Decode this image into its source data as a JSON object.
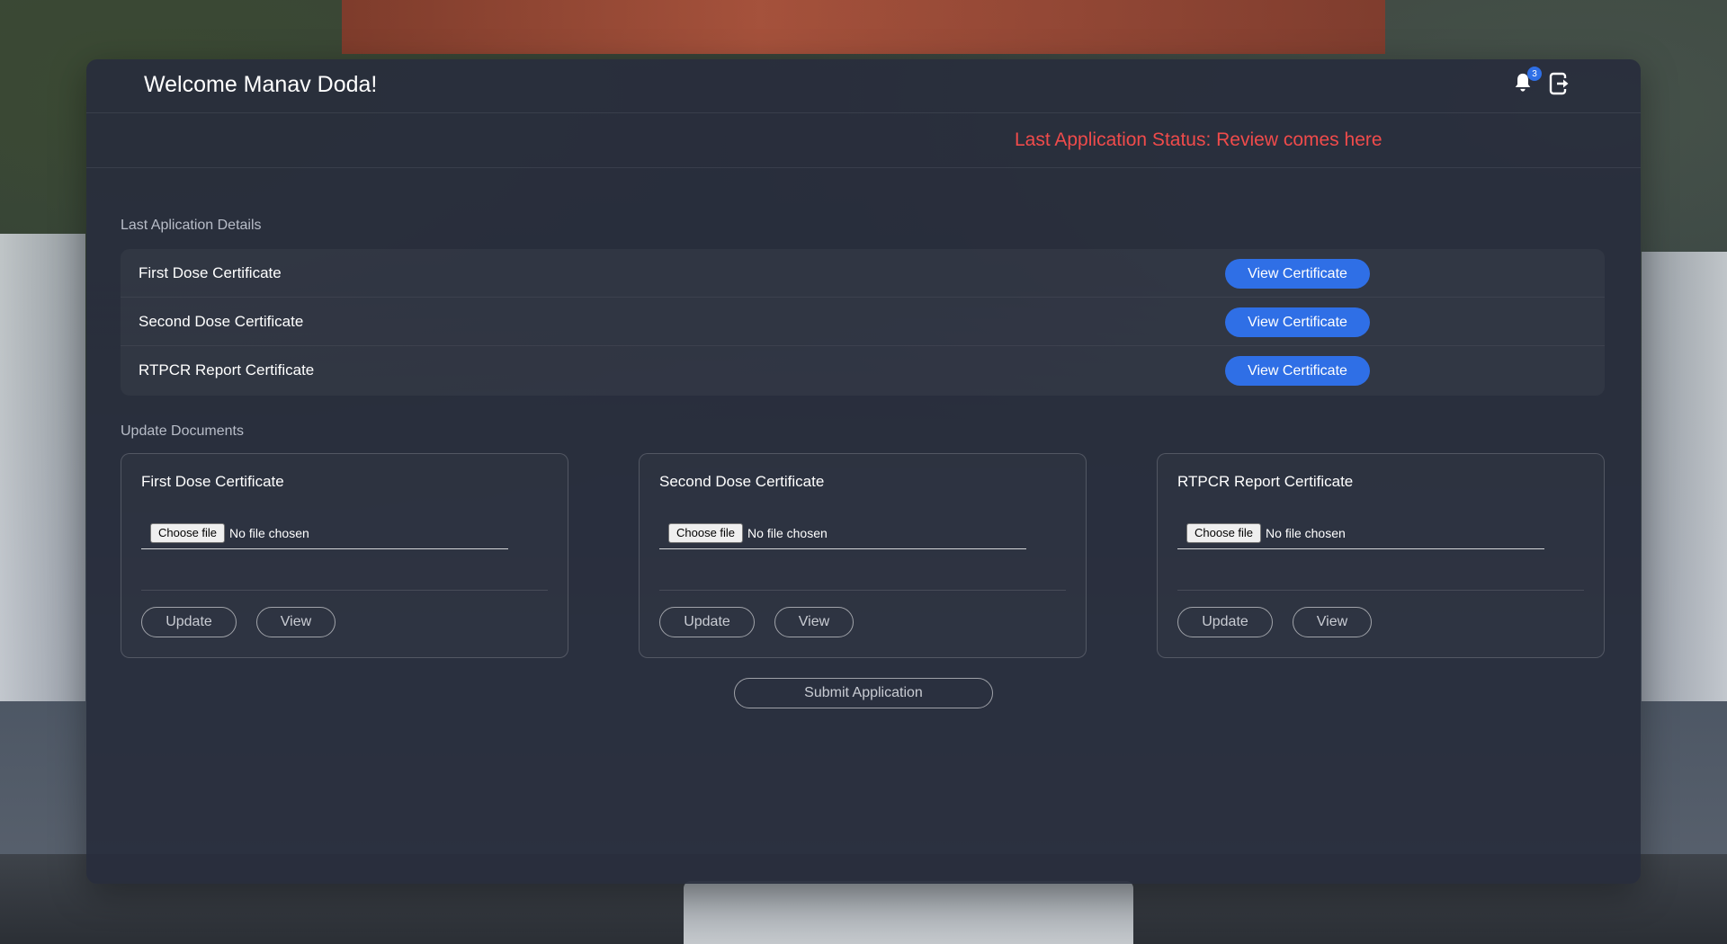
{
  "header": {
    "welcome": "Welcome Manav Doda!",
    "notification_count": "3",
    "notification_icon": "bell-icon",
    "logout_icon": "logout-icon"
  },
  "status": {
    "text": "Last Application Status: Review comes here",
    "color": "#f04b4b"
  },
  "details": {
    "label": "Last Aplication Details",
    "rows": [
      {
        "name": "First Dose Certificate",
        "button": "View Certificate"
      },
      {
        "name": "Second Dose Certificate",
        "button": "View Certificate"
      },
      {
        "name": "RTPCR Report Certificate",
        "button": "View Certificate"
      }
    ]
  },
  "update": {
    "label": "Update Documents",
    "cards": [
      {
        "title": "First Dose Certificate",
        "choose": "Choose file",
        "file_status": "No file chosen",
        "update": "Update",
        "view": "View"
      },
      {
        "title": "Second Dose Certificate",
        "choose": "Choose file",
        "file_status": "No file chosen",
        "update": "Update",
        "view": "View"
      },
      {
        "title": "RTPCR Report Certificate",
        "choose": "Choose file",
        "file_status": "No file chosen",
        "update": "Update",
        "view": "View"
      }
    ]
  },
  "submit": "Submit Application",
  "colors": {
    "accent": "#2f6fe6",
    "status": "#f04b4b"
  }
}
